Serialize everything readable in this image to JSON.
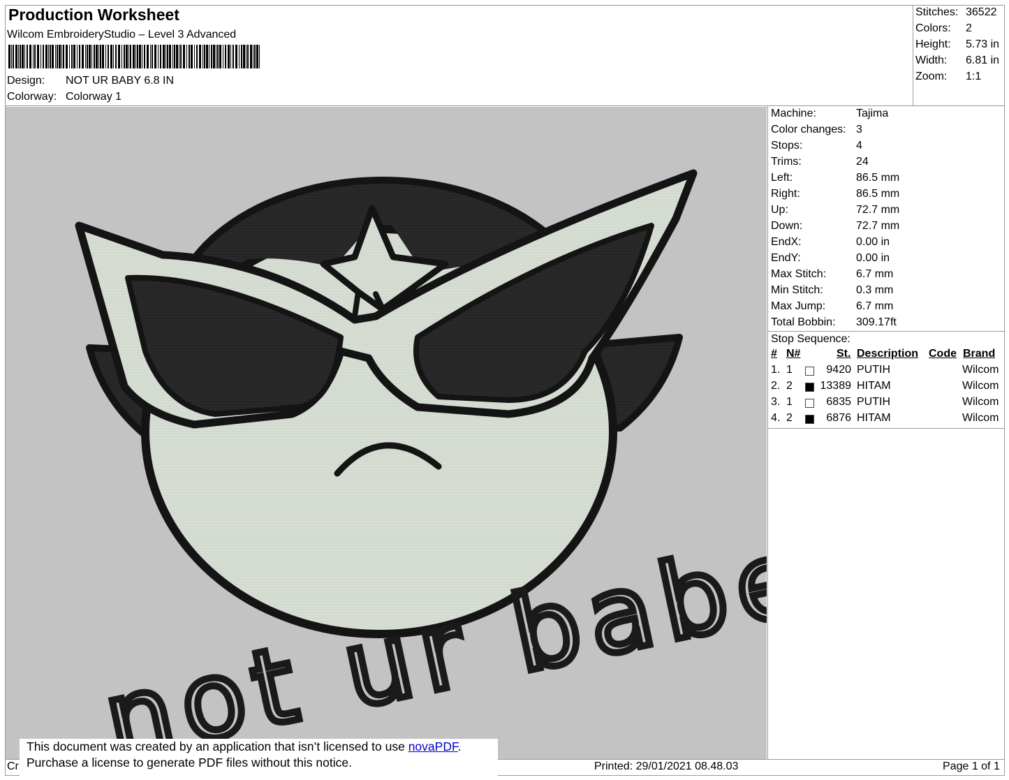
{
  "header": {
    "title": "Production Worksheet",
    "software": "Wilcom EmbroideryStudio – Level 3 Advanced",
    "design_label": "Design:",
    "design_value": "NOT UR BABY 6.8 IN",
    "colorway_label": "Colorway:",
    "colorway_value": "Colorway 1"
  },
  "summary": [
    {
      "label": "Stitches:",
      "value": "36522"
    },
    {
      "label": "Colors:",
      "value": "2"
    },
    {
      "label": "Height:",
      "value": "5.73 in"
    },
    {
      "label": "Width:",
      "value": "6.81 in"
    },
    {
      "label": "Zoom:",
      "value": "1:1"
    }
  ],
  "machine_info": [
    {
      "label": "Machine:",
      "value": "Tajima"
    },
    {
      "label": "Color changes:",
      "value": "3"
    },
    {
      "label": "Stops:",
      "value": "4"
    },
    {
      "label": "Trims:",
      "value": "24"
    },
    {
      "label": "Left:",
      "value": "86.5 mm"
    },
    {
      "label": "Right:",
      "value": "86.5 mm"
    },
    {
      "label": "Up:",
      "value": "72.7 mm"
    },
    {
      "label": "Down:",
      "value": "72.7 mm"
    },
    {
      "label": "EndX:",
      "value": "0.00 in"
    },
    {
      "label": "EndY:",
      "value": "0.00 in"
    },
    {
      "label": "Max Stitch:",
      "value": "6.7 mm"
    },
    {
      "label": "Min Stitch:",
      "value": "0.3 mm"
    },
    {
      "label": "Max Jump:",
      "value": "6.7 mm"
    },
    {
      "label": "Total Bobbin:",
      "value": "309.17ft"
    }
  ],
  "stop_sequence": {
    "title": "Stop Sequence:",
    "columns": {
      "num": "#",
      "needle": "N#",
      "stitches": "St.",
      "description": "Description",
      "code": "Code",
      "brand": "Brand"
    },
    "rows": [
      {
        "num": "1.",
        "needle": "1",
        "color": "#ffffff",
        "stitches": "9420",
        "description": "PUTIH",
        "code": "",
        "brand": "Wilcom"
      },
      {
        "num": "2.",
        "needle": "2",
        "color": "#000000",
        "stitches": "13389",
        "description": "HITAM",
        "code": "",
        "brand": "Wilcom"
      },
      {
        "num": "3.",
        "needle": "1",
        "color": "#ffffff",
        "stitches": "6835",
        "description": "PUTIH",
        "code": "",
        "brand": "Wilcom"
      },
      {
        "num": "4.",
        "needle": "2",
        "color": "#000000",
        "stitches": "6876",
        "description": "HITAM",
        "code": "",
        "brand": "Wilcom"
      }
    ]
  },
  "artwork": {
    "text": "not ur babe.",
    "background_color": "#c3c3c3",
    "fill_light": "#d6ddd2",
    "fill_dark": "#262626"
  },
  "notice": {
    "line1_prefix": "This document was created by an application that isn’t licensed to use ",
    "link_text": "novaPDF",
    "line1_suffix": ".",
    "line2": "Purchase a license to generate PDF files without this notice."
  },
  "footer": {
    "left_fragment": "Cr",
    "printed": "Printed: 29/01/2021 08.48.03",
    "page": "Page 1 of 1"
  }
}
